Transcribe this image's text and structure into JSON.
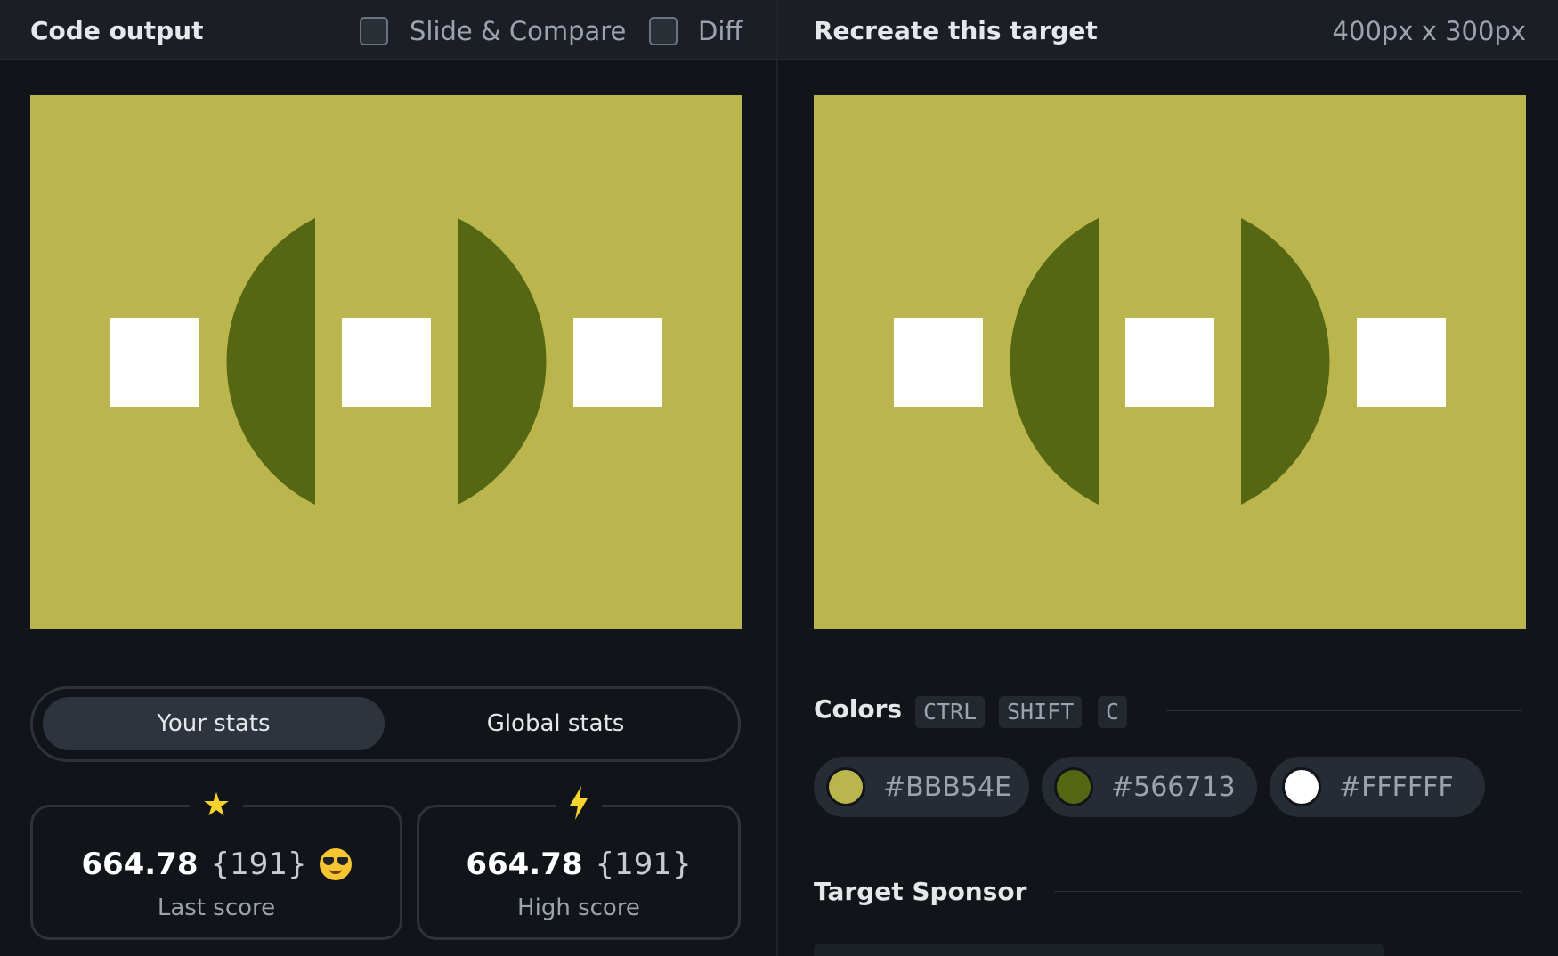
{
  "left": {
    "title": "Code output",
    "options": [
      {
        "label": "Slide & Compare",
        "checked": false
      },
      {
        "label": "Diff",
        "checked": false
      }
    ]
  },
  "right": {
    "title": "Recreate this target",
    "dimensions": "400px x 300px"
  },
  "stats": {
    "tabs": [
      "Your stats",
      "Global stats"
    ],
    "active_tab": "Your stats",
    "last": {
      "icon": "star-icon",
      "score": "664.78",
      "rank": "{191}",
      "emoji": "sunglasses-emoji",
      "label": "Last score"
    },
    "high": {
      "icon": "lightning-icon",
      "score": "664.78",
      "rank": "{191}",
      "label": "High score"
    }
  },
  "colors": {
    "title": "Colors",
    "shortcut": [
      "CTRL",
      "SHIFT",
      "C"
    ],
    "swatches": [
      {
        "hex": "#BBB54E"
      },
      {
        "hex": "#566713"
      },
      {
        "hex": "#FFFFFF"
      }
    ]
  },
  "sponsor": {
    "title": "Target Sponsor"
  }
}
